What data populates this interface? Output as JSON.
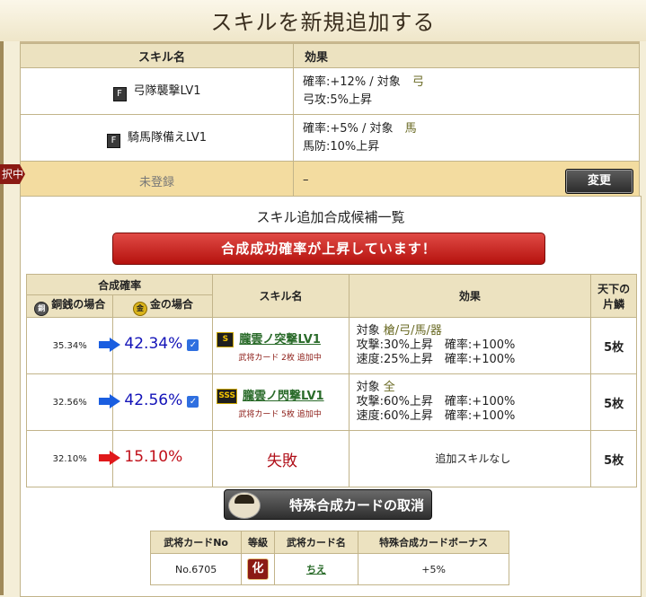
{
  "title": "スキルを新規追加する",
  "current_table": {
    "headers": [
      "スキル名",
      "効果"
    ],
    "rows": [
      {
        "badge": "F",
        "name": "弓隊襲撃LV1",
        "effect_line1": "確率:+12% / 対象",
        "target": "弓",
        "effect_line2": "弓攻:5%上昇"
      },
      {
        "badge": "F",
        "name": "騎馬隊備えLV1",
        "effect_line1": "確率:+5% / 対象",
        "target": "馬",
        "effect_line2": "馬防:10%上昇"
      }
    ],
    "unregistered": {
      "name": "未登録",
      "effect": "–"
    },
    "change_label": "変更",
    "ribbon_label": "択中"
  },
  "candidates": {
    "heading": "スキル追加合成候補一覧",
    "banner": "合成成功確率が上昇しています！",
    "headers": {
      "rate": "合成確率",
      "copper": "銅銭の場合",
      "gold": "金の場合",
      "skill": "スキル名",
      "effect": "効果",
      "count": "天下の片鱗"
    },
    "coin_copper": "銅",
    "coin_gold": "金",
    "rows": [
      {
        "base": "35.34%",
        "gold": "42.34%",
        "checked": true,
        "arrow": "blue",
        "rank": "S",
        "skill": "朧雲ノ突撃LV1",
        "sub": "武将カード 2枚 追加中",
        "eff1": "対象 ",
        "eff1_target": "槍/弓/馬/器",
        "eff2": "攻撃:30%上昇　確率:+100%",
        "eff3": "速度:25%上昇　確率:+100%",
        "count": "5枚"
      },
      {
        "base": "32.56%",
        "gold": "42.56%",
        "checked": true,
        "arrow": "blue",
        "rank": "SSS",
        "skill": "朧雲ノ閃撃LV1",
        "sub": "武将カード 5枚 追加中",
        "eff1": "対象 ",
        "eff1_target": "全",
        "eff2": "攻撃:60%上昇　確率:+100%",
        "eff3": "速度:60%上昇　確率:+100%",
        "count": "5枚"
      },
      {
        "base": "32.10%",
        "gold": "15.10%",
        "checked": false,
        "arrow": "red",
        "skill_fail": "失敗",
        "effect_none": "追加スキルなし",
        "count": "5枚"
      }
    ]
  },
  "cancel_button": "特殊合成カードの取消",
  "card_table": {
    "headers": [
      "武将カードNo",
      "等級",
      "武将カード名",
      "特殊合成カードボーナス"
    ],
    "row": {
      "no": "No.6705",
      "grade": "化",
      "name": "ちえ",
      "bonus": "+5%"
    }
  },
  "colors": {
    "blue_arrow": "#1a5ee0",
    "red_arrow": "#e0181a",
    "banner": "#c81c16",
    "header_bg": "#ece2c0"
  }
}
